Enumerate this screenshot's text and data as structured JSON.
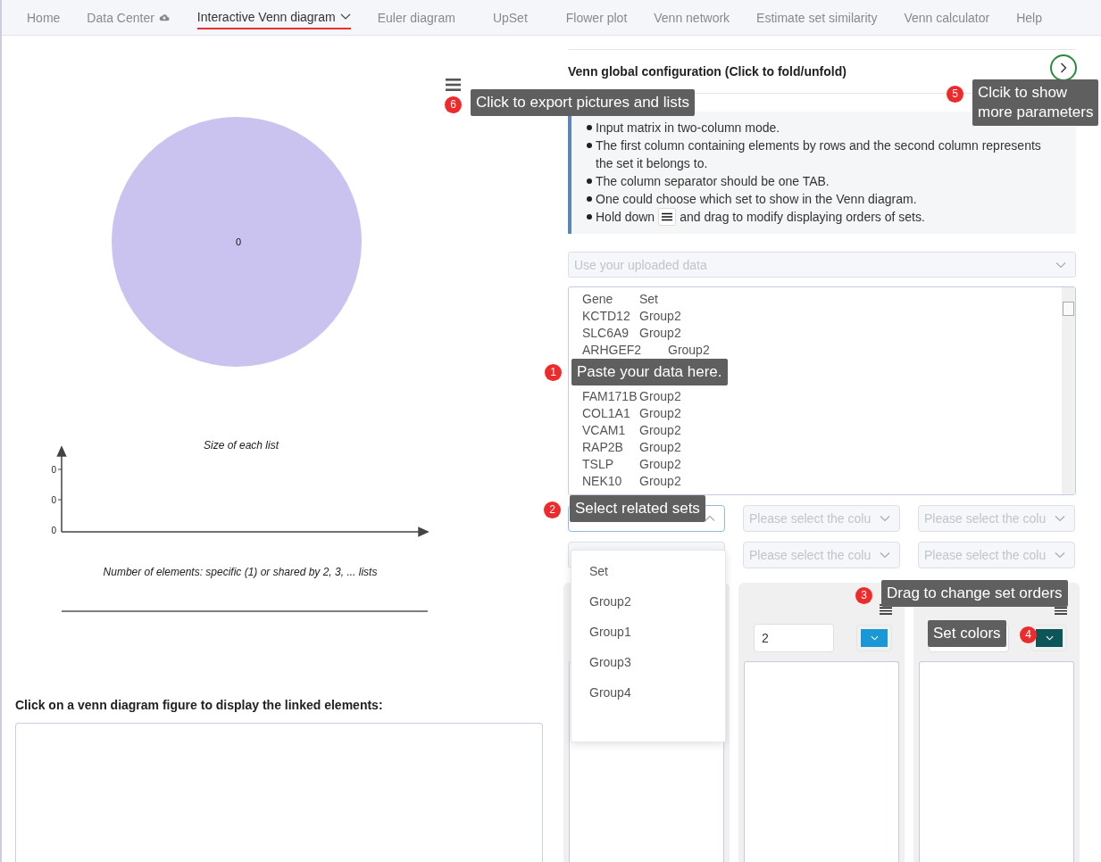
{
  "nav": [
    {
      "label": "Home",
      "kind": "plain",
      "selected": false
    },
    {
      "label": "Data Center",
      "kind": "cloud",
      "selected": false
    },
    {
      "label": "Interactive Venn diagram",
      "kind": "dropdown",
      "selected": true
    },
    {
      "label": "Euler diagram",
      "kind": "plain",
      "selected": false
    },
    {
      "label": "UpSet",
      "kind": "plain",
      "selected": false
    },
    {
      "label": "Flower plot",
      "kind": "plain",
      "selected": false
    },
    {
      "label": "Venn network",
      "kind": "plain",
      "selected": false
    },
    {
      "label": "Estimate set similarity",
      "kind": "plain",
      "selected": false
    },
    {
      "label": "Venn calculator",
      "kind": "plain",
      "selected": false
    },
    {
      "label": "Help",
      "kind": "plain",
      "selected": false
    }
  ],
  "venn": {
    "label": "0"
  },
  "size_chart": {
    "title": "Size of each list",
    "y_labels": [
      "0",
      "0",
      "0"
    ],
    "xlabel": "Number of elements: specific (1) or shared by 2, 3, ... lists"
  },
  "linked": {
    "label": "Click on a venn diagram figure to display the linked elements:"
  },
  "config": {
    "title": "Venn global configuration (Click to fold/unfold)"
  },
  "instructions": [
    {
      "kind": "plain",
      "text": "Input matrix in two-column mode."
    },
    {
      "kind": "plain",
      "text": "The first column containing elements by rows and the second column represents the set it belongs to."
    },
    {
      "kind": "plain",
      "text": "The column separator should be one TAB."
    },
    {
      "kind": "plain",
      "text": "One could choose which set to show in the Venn diagram."
    },
    {
      "kind": "handle",
      "text": "Hold down",
      "after": "and drag to modify displaying orders of sets."
    }
  ],
  "data_source": {
    "placeholder": "Use your uploaded data"
  },
  "data_rows": [
    [
      "Gene",
      "Set"
    ],
    [
      "KCTD12",
      "Group2"
    ],
    [
      "SLC6A9",
      "Group2"
    ],
    [
      "ARHGEF2",
      "Group2"
    ],
    [
      "FAM171B",
      "Group2"
    ],
    [
      "COL1A1",
      "Group2"
    ],
    [
      "VCAM1",
      "Group2"
    ],
    [
      "RAP2B",
      "Group2"
    ],
    [
      "TSLP",
      "Group2"
    ],
    [
      "NEK10",
      "Group2"
    ]
  ],
  "column_selects": [
    {
      "open": true
    },
    {
      "open": false,
      "placeholder": "Please select the colu"
    },
    {
      "open": false,
      "placeholder": "Please select the colu"
    },
    {
      "open": false
    },
    {
      "open": false,
      "placeholder": "Please select the colu"
    },
    {
      "open": false,
      "placeholder": "Please select the colu"
    }
  ],
  "dropdown_options": [
    "Set",
    "Group2",
    "Group1",
    "Group3",
    "Group4"
  ],
  "panels": [
    {
      "value": "2",
      "color": "#1a97d5"
    },
    {
      "color": "#0e5557"
    }
  ],
  "tooltips": [
    {
      "number": "6",
      "text": "Click to export pictures and lists"
    },
    {
      "number": "5",
      "text": "Clcik to show\nmore parameters"
    },
    {
      "number": "1",
      "text": "Paste your data here."
    },
    {
      "number": "2",
      "text": "Select related sets"
    },
    {
      "number": "3",
      "text": "Drag to change set orders"
    },
    {
      "number": "4",
      "text": "Set colors"
    }
  ]
}
